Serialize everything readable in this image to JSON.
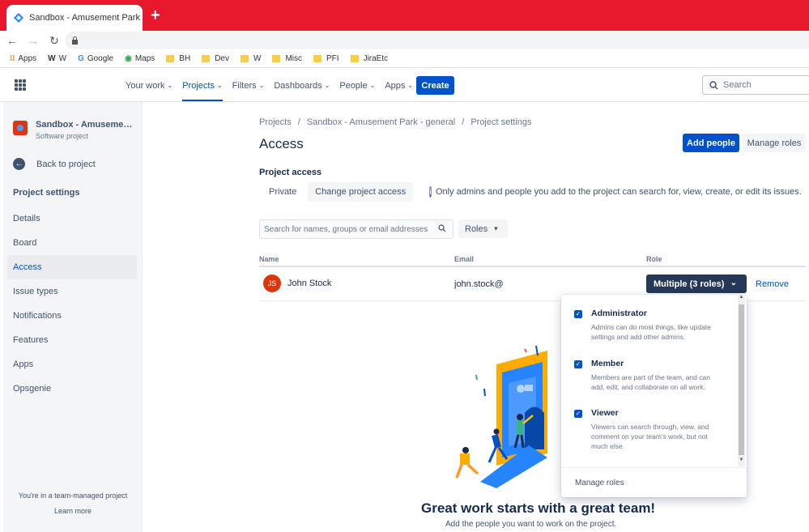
{
  "browser": {
    "tab_title": "Sandbox - Amusement Park - ge",
    "new_tab": "+",
    "bookmarks": [
      {
        "label": "Apps",
        "icon": "apps-grid-icon"
      },
      {
        "label": "W",
        "icon": "wikipedia-icon"
      },
      {
        "label": "Google",
        "icon": "google-icon"
      },
      {
        "label": "Maps",
        "icon": "maps-icon"
      },
      {
        "label": "BH",
        "icon": "folder-icon"
      },
      {
        "label": "Dev",
        "icon": "folder-icon"
      },
      {
        "label": "W",
        "icon": "folder-icon"
      },
      {
        "label": "Misc",
        "icon": "folder-icon"
      },
      {
        "label": "PFI",
        "icon": "folder-icon"
      },
      {
        "label": "JiraEtc",
        "icon": "folder-icon"
      }
    ]
  },
  "topnav": {
    "items": [
      "Your work",
      "Projects",
      "Filters",
      "Dashboards",
      "People",
      "Apps"
    ],
    "active": "Projects",
    "create": "Create",
    "search_placeholder": "Search"
  },
  "sidebar": {
    "project_name": "Sandbox - Amusement ...",
    "project_type": "Software project",
    "back": "Back to project",
    "section": "Project settings",
    "items": [
      "Details",
      "Board",
      "Access",
      "Issue types",
      "Notifications",
      "Features",
      "Apps",
      "Opsgenie"
    ],
    "selected": "Access",
    "footer_text": "You're in a team-managed project",
    "footer_link": "Learn more"
  },
  "main": {
    "breadcrumb": [
      "Projects",
      "Sandbox - Amusement Park - general",
      "Project settings"
    ],
    "title": "Access",
    "add_people": "Add people",
    "manage_roles": "Manage roles",
    "project_access_label": "Project access",
    "access_level": "Private",
    "change_access": "Change project access",
    "info_text": "Only admins and people you add to the project can search for, view, create, or edit its issues.",
    "search_placeholder": "Search for names, groups or email addresses",
    "roles_filter": "Roles",
    "columns": [
      "Name",
      "Email",
      "Role"
    ],
    "row": {
      "initials": "JS",
      "name": "John Stock",
      "email": "john.stock@",
      "role": "Multiple (3 roles)",
      "remove": "Remove"
    },
    "empty_title": "Great work starts with a great team!",
    "empty_sub": "Add the people you want to work on the project."
  },
  "roles_dropdown": {
    "options": [
      {
        "title": "Administrator",
        "desc": "Admins can do most things, like update settings and add other admins.",
        "checked": true
      },
      {
        "title": "Member",
        "desc": "Members are part of the team, and can add, edit, and collaborate on all work.",
        "checked": true
      },
      {
        "title": "Viewer",
        "desc": "Viewers can search through, view, and comment on your team's work, but not much else.",
        "checked": true
      }
    ],
    "manage": "Manage roles"
  },
  "colors": {
    "brand": "#0052cc",
    "chrome_red": "#e8192c",
    "role_button": "#253858",
    "avatar": "#de350b"
  }
}
